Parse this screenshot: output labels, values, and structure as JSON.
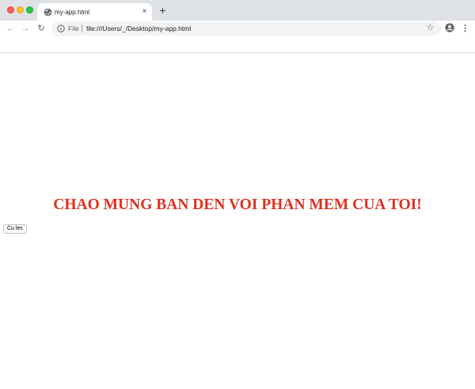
{
  "browser": {
    "tab": {
      "title": "my-app.html",
      "close": "×"
    },
    "new_tab": "+",
    "nav": {
      "back": "←",
      "forward": "→",
      "reload": "↻"
    },
    "address": {
      "scheme_label": "File",
      "url": "file:///Users/_/Desktop/my-app.html"
    },
    "icons": {
      "tab": "globe-icon",
      "site_info": "info-icon",
      "bookmark": "star-icon",
      "profile": "profile-icon",
      "menu": "kebab-menu-icon"
    },
    "colors": {
      "tabstrip": "#dee1e6",
      "omnibox": "#f1f3f4"
    }
  },
  "page": {
    "heading": "CHAO MUNG BAN DEN VOI PHAN MEM CUA TOI!",
    "button_label": "Cu lec",
    "colors": {
      "heading": "#e0301e"
    }
  }
}
